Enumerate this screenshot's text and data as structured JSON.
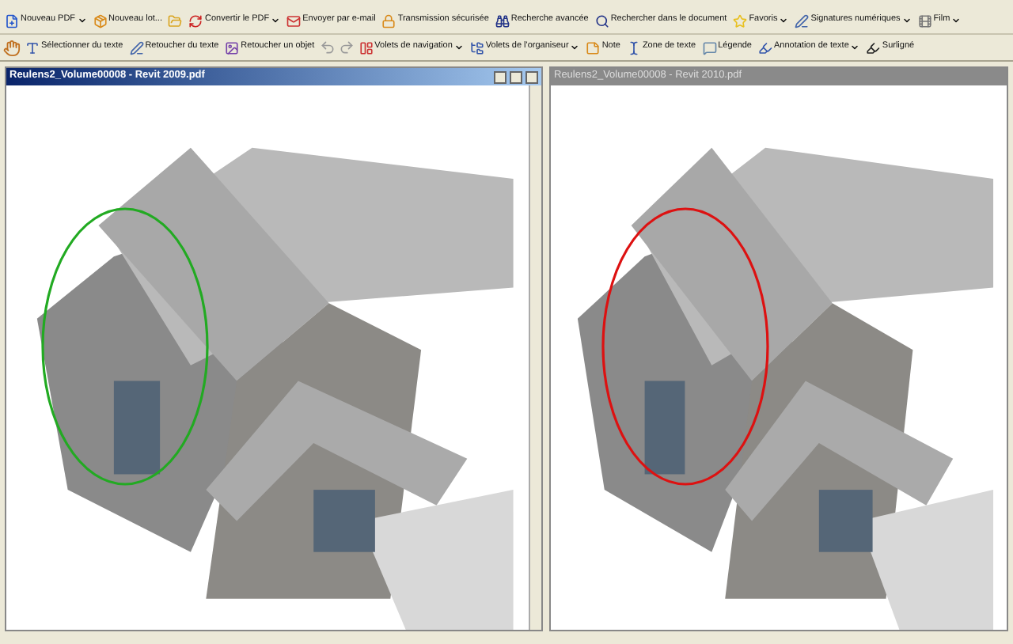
{
  "toolbar_1": [
    {
      "label": "Nouveau PDF",
      "dropdown": true
    },
    {
      "label": "Nouveau lot...",
      "dropdown": false
    },
    {
      "dropdown": false
    },
    {
      "label": "Convertir le PDF",
      "dropdown": true
    },
    {
      "label": "Envoyer par e-mail",
      "dropdown": false
    },
    {
      "label": "Transmission sécurisée",
      "dropdown": false
    },
    {
      "label": "Recherche avancée",
      "dropdown": false
    },
    {
      "label": "Rechercher dans le document",
      "dropdown": false
    },
    {
      "label": "Favoris",
      "dropdown": true
    },
    {
      "label": "Signatures numériques",
      "dropdown": true
    },
    {
      "label": "Film",
      "dropdown": true
    }
  ],
  "toolbar_2": [
    {
      "label": "Sélectionner du texte",
      "dropdown": false
    },
    {
      "label": "Retoucher du texte",
      "dropdown": false
    },
    {
      "label": "Retoucher un objet",
      "dropdown": false
    },
    {
      "label": "Volets de navigation",
      "dropdown": true
    },
    {
      "label": "Volets de l'organiseur",
      "dropdown": true
    },
    {
      "label": "Note",
      "dropdown": false
    },
    {
      "label": "Zone de texte",
      "dropdown": false
    },
    {
      "label": "Légende",
      "dropdown": false
    },
    {
      "label": "Annotation de texte",
      "dropdown": true
    },
    {
      "label": "Surligné",
      "dropdown": false
    }
  ],
  "windows": [
    {
      "title": "Reulens2_Volume00008 - Revit 2009.pdf",
      "active": true,
      "color": "#22aa22"
    },
    {
      "title": "Reulens2_Volume00008 - Revit 2010.pdf",
      "active": false,
      "color": "#dd1111"
    }
  ]
}
